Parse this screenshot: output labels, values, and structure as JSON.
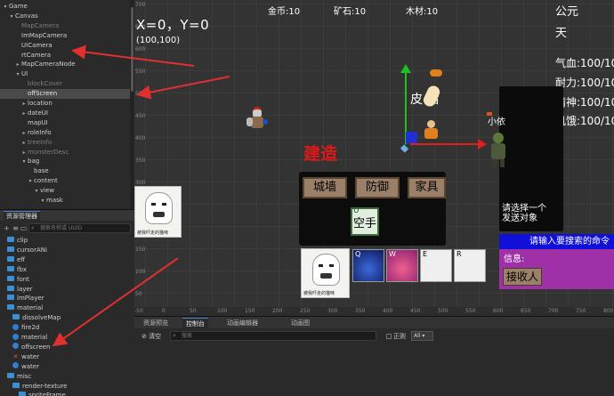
{
  "hierarchy": {
    "rows": [
      {
        "label": "Game",
        "arrow": "▾",
        "dim": false
      },
      {
        "label": "Canvas",
        "arrow": "▾",
        "dim": false
      },
      {
        "label": "MapCamera",
        "arrow": "",
        "dim": true
      },
      {
        "label": "ImMapCamera",
        "arrow": "",
        "dim": false
      },
      {
        "label": "UICamera",
        "arrow": "",
        "dim": false
      },
      {
        "label": "rtCamera",
        "arrow": "",
        "dim": false
      },
      {
        "label": "MapCameraNode",
        "arrow": "▸",
        "dim": false
      },
      {
        "label": "UI",
        "arrow": "▾",
        "dim": false
      },
      {
        "label": "blockCover",
        "arrow": "",
        "dim": true
      },
      {
        "label": "offScreen",
        "arrow": "",
        "dim": false
      },
      {
        "label": "location",
        "arrow": "▸",
        "dim": false
      },
      {
        "label": "dateUI",
        "arrow": "▸",
        "dim": false
      },
      {
        "label": "mapUI",
        "arrow": "",
        "dim": false
      },
      {
        "label": "roleInfo",
        "arrow": "▸",
        "dim": false
      },
      {
        "label": "treeInfo",
        "arrow": "▸",
        "dim": true
      },
      {
        "label": "monsterDesc",
        "arrow": "▸",
        "dim": true
      },
      {
        "label": "bag",
        "arrow": "▾",
        "dim": false
      },
      {
        "label": "base",
        "arrow": "",
        "dim": false
      },
      {
        "label": "content",
        "arrow": "▾",
        "dim": false
      },
      {
        "label": "view",
        "arrow": "▾",
        "dim": false
      },
      {
        "label": "mask",
        "arrow": "▾",
        "dim": false
      }
    ]
  },
  "assets": {
    "tab_label": "资源管理器",
    "search_placeholder": "搜索名称或 UUID",
    "rows": [
      {
        "label": "clip",
        "kind": "folder"
      },
      {
        "label": "cursorANi",
        "kind": "folder"
      },
      {
        "label": "eff",
        "kind": "folder"
      },
      {
        "label": "fbx",
        "kind": "folder"
      },
      {
        "label": "font",
        "kind": "folder"
      },
      {
        "label": "layer",
        "kind": "folder"
      },
      {
        "label": "lmPlayer",
        "kind": "folder"
      },
      {
        "label": "material",
        "kind": "folder"
      },
      {
        "label": "dissolveMap",
        "kind": "folder"
      },
      {
        "label": "fire2d",
        "kind": "ball"
      },
      {
        "label": "material",
        "kind": "ball"
      },
      {
        "label": "offscreen",
        "kind": "ball"
      },
      {
        "label": "water",
        "kind": "spark"
      },
      {
        "label": "water",
        "kind": "ball"
      },
      {
        "label": "misc",
        "kind": "folder"
      },
      {
        "label": "render-texture",
        "kind": "folder"
      },
      {
        "label": "spriteFrame",
        "kind": "folder"
      }
    ]
  },
  "scene": {
    "coord": "X=0，Y=0",
    "coord_sub": "(100,100)",
    "gold": "金币:10",
    "ore": "矿石:10",
    "wood": "木材:10",
    "era_1": "公元",
    "era_2": "天",
    "stat_hp": "气血:100/10",
    "stat_stamina": "耐力:100/10",
    "stat_spirit": "精神:100/10",
    "stat_hunger": "饥饿:100/10",
    "build_title": "建造",
    "build_tabs": [
      "城墙",
      "防御",
      "家具"
    ],
    "slot_key": "U",
    "slot_label": "空手",
    "label_pig": "皮  猪",
    "label_yi": "小依",
    "select_hint_1": "请选择一个",
    "select_hint_2": "发送对象",
    "search_hint": "请输入要搜索的命令",
    "info_label": "信息:",
    "receiver_label": "接收人",
    "skill_keys": [
      "Q",
      "W",
      "E",
      "R"
    ],
    "meme_caption": "被我吓走的猫咪",
    "ruler_bottom": [
      "-50",
      "0",
      "50",
      "100",
      "150",
      "200",
      "250",
      "300",
      "350",
      "400",
      "450",
      "500",
      "550",
      "600",
      "650",
      "700",
      "750",
      "800"
    ],
    "ruler_left": [
      "700",
      "650",
      "600",
      "550",
      "500",
      "450",
      "400",
      "350",
      "300",
      "250",
      "200",
      "150",
      "100",
      "50"
    ]
  },
  "console": {
    "tabs": [
      "资源预览",
      "控制台",
      "动画编辑器",
      "动画图"
    ],
    "clear_label": "清空",
    "search_placeholder": "搜索",
    "regex_label": "正则",
    "level_value": "All"
  },
  "colors": {
    "arrow": "#e03030",
    "accent": "#4a7fd0"
  }
}
